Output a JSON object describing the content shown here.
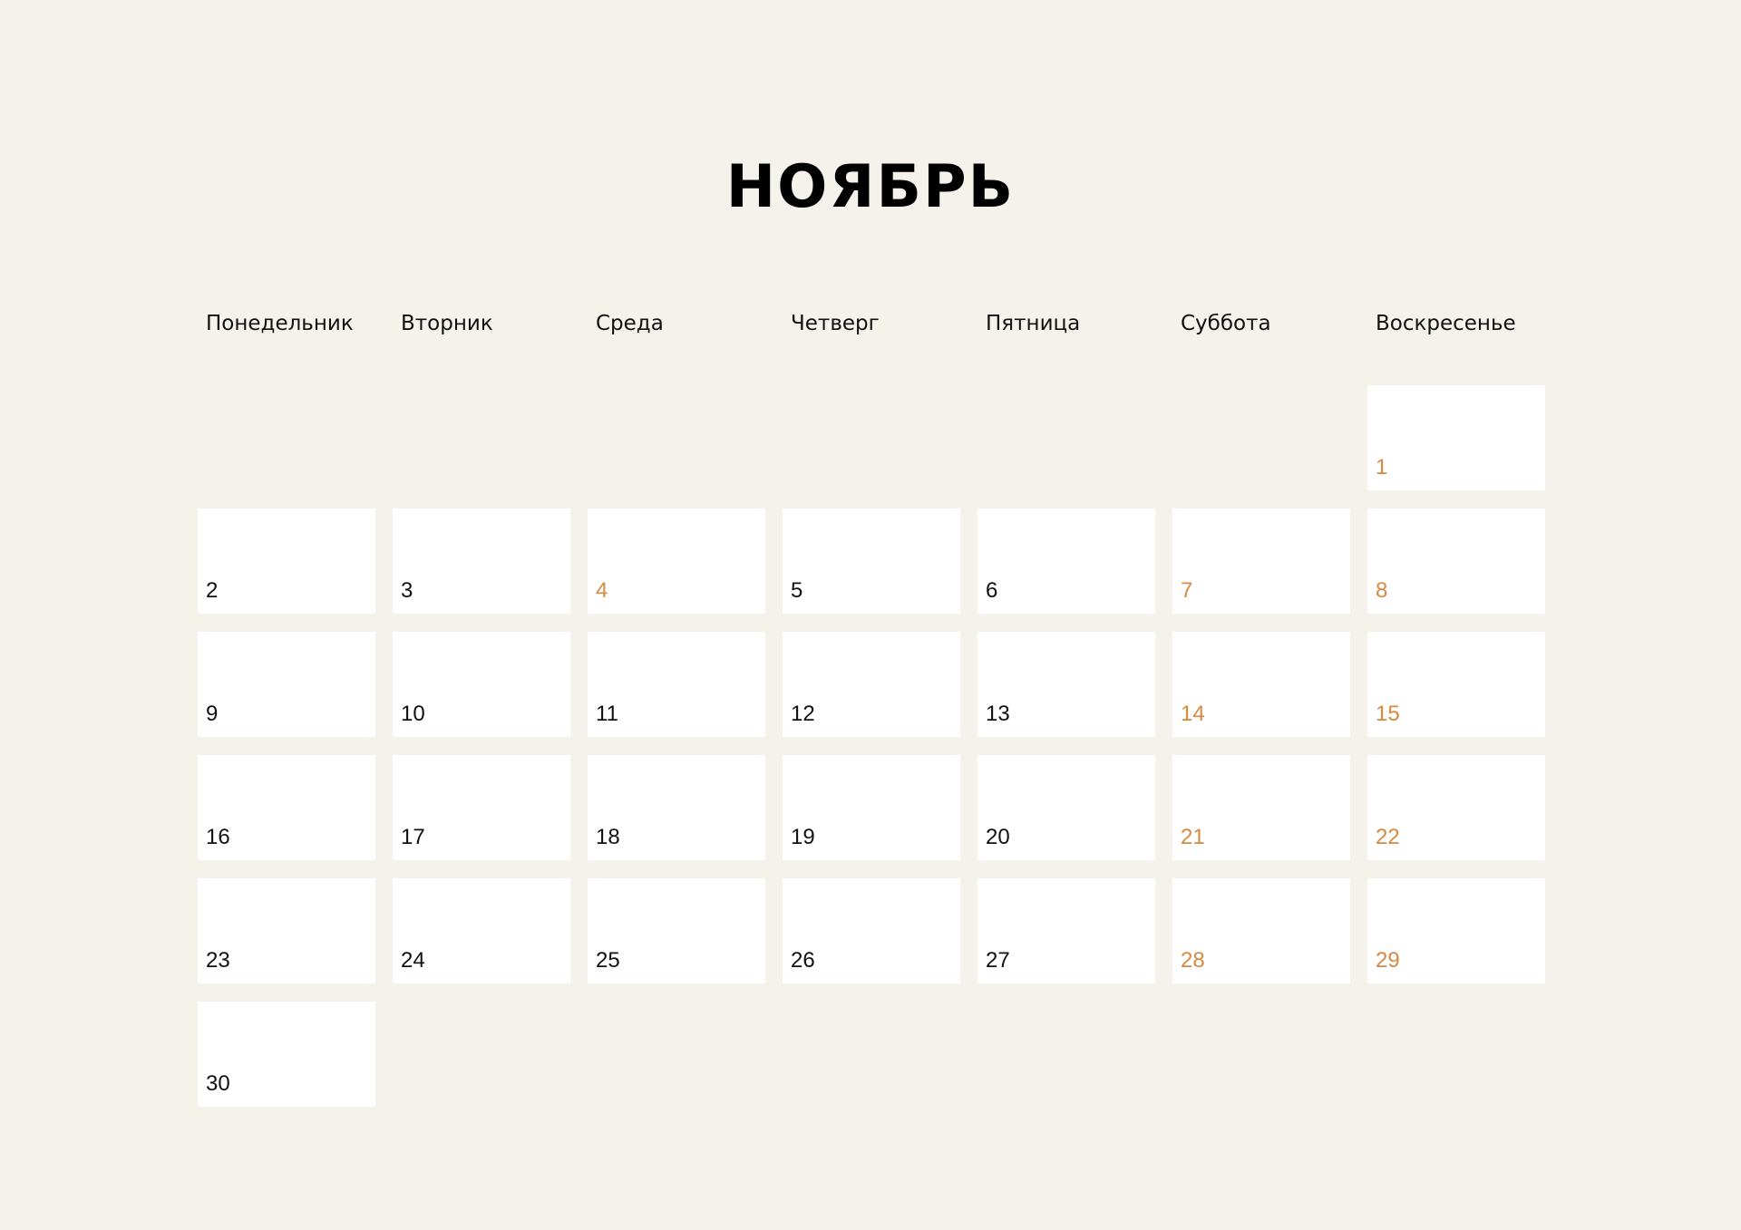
{
  "calendar": {
    "month_title": "НОЯБРЬ",
    "weekdays": [
      "Понедельник",
      "Вторник",
      "Среда",
      "Четверг",
      "Пятница",
      "Суббота",
      "Воскресенье"
    ],
    "colors": {
      "background": "#f5f2ec",
      "cell": "#ffffff",
      "regular_day": "#111111",
      "highlighted_day": "#d8893f"
    },
    "weeks": [
      [
        null,
        null,
        null,
        null,
        null,
        null,
        {
          "day": "1",
          "highlighted": true
        }
      ],
      [
        {
          "day": "2",
          "highlighted": false
        },
        {
          "day": "3",
          "highlighted": false
        },
        {
          "day": "4",
          "highlighted": true
        },
        {
          "day": "5",
          "highlighted": false
        },
        {
          "day": "6",
          "highlighted": false
        },
        {
          "day": "7",
          "highlighted": true
        },
        {
          "day": "8",
          "highlighted": true
        }
      ],
      [
        {
          "day": "9",
          "highlighted": false
        },
        {
          "day": "10",
          "highlighted": false
        },
        {
          "day": "11",
          "highlighted": false
        },
        {
          "day": "12",
          "highlighted": false
        },
        {
          "day": "13",
          "highlighted": false
        },
        {
          "day": "14",
          "highlighted": true
        },
        {
          "day": "15",
          "highlighted": true
        }
      ],
      [
        {
          "day": "16",
          "highlighted": false
        },
        {
          "day": "17",
          "highlighted": false
        },
        {
          "day": "18",
          "highlighted": false
        },
        {
          "day": "19",
          "highlighted": false
        },
        {
          "day": "20",
          "highlighted": false
        },
        {
          "day": "21",
          "highlighted": true
        },
        {
          "day": "22",
          "highlighted": true
        }
      ],
      [
        {
          "day": "23",
          "highlighted": false
        },
        {
          "day": "24",
          "highlighted": false
        },
        {
          "day": "25",
          "highlighted": false
        },
        {
          "day": "26",
          "highlighted": false
        },
        {
          "day": "27",
          "highlighted": false
        },
        {
          "day": "28",
          "highlighted": true
        },
        {
          "day": "29",
          "highlighted": true
        }
      ],
      [
        {
          "day": "30",
          "highlighted": false
        },
        null,
        null,
        null,
        null,
        null,
        null
      ]
    ]
  }
}
